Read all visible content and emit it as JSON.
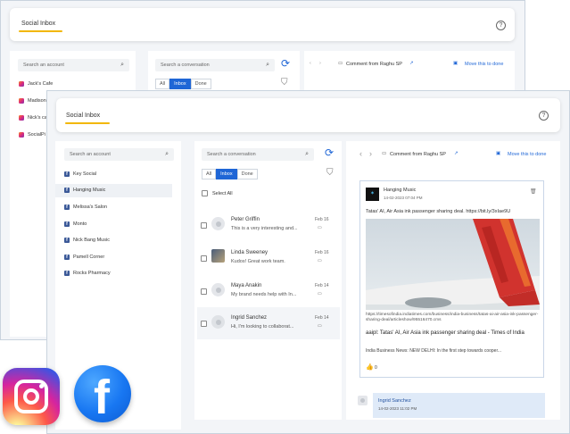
{
  "back": {
    "title": "Social Inbox",
    "help": "?",
    "account_search_placeholder": "Search an account",
    "accounts": [
      "Jack's Cafe",
      "Madison",
      "Nick's ca",
      "SocialPi"
    ],
    "conversation_search_placeholder": "Search a conversation",
    "tabs": [
      "All",
      "Inbox",
      "Done"
    ],
    "comment_from": "Comment from Raghu SP",
    "move_to_done": "Move this to done"
  },
  "front": {
    "title": "Social Inbox",
    "help": "?",
    "account_search_placeholder": "Search an account",
    "accounts": [
      "Key Social",
      "Hanging Music",
      "Melissa's Salon",
      "Monto",
      "Nick Bang Music",
      "Pamell Corner",
      "Rocks Pharmacy"
    ],
    "conversation_search_placeholder": "Search a conversation",
    "tabs": [
      "All",
      "Inbox",
      "Done"
    ],
    "select_all": "Select All",
    "conversations": [
      {
        "name": "Peter Griffin",
        "preview": "This is a very interesting and...",
        "date": "Feb 16"
      },
      {
        "name": "Linda Sweeney",
        "preview": "Kudos! Great work team.",
        "date": "Feb 16"
      },
      {
        "name": "Maya Anakin",
        "preview": "My brand needs help with In...",
        "date": "Feb 14"
      },
      {
        "name": "Ingrid Sanchez",
        "preview": "Hi, I'm looking to collaborat...",
        "date": "Feb 14"
      }
    ],
    "comment_from": "Comment from Raghu SP",
    "move_to_done": "Move this to done",
    "post": {
      "page_name": "Hanging Music",
      "timestamp": "14-02-2023 07:04 PM",
      "text": "Tatas' AI, Air Asia ink passenger sharing deal. https://bit.ly/3xIae9U",
      "link_url": "https://timesofindia.indiatimes.com/business/india-business/tatas-ai-air-asia-ink-passenger-sharing-deal/articleshow/95516470.cms",
      "link_title": "aaipl: Tatas' AI, Air Asia ink passenger sharing deal - Times of India",
      "link_desc": "India Business News: NEW DELHI: In the first step towards cooper...",
      "likes": "0"
    },
    "reply": {
      "name": "Ingrid Sanchez",
      "timestamp": "14-02-2023 11:02 PM"
    }
  },
  "colors": {
    "accent": "#1f66d6",
    "underline": "#f2b705"
  }
}
